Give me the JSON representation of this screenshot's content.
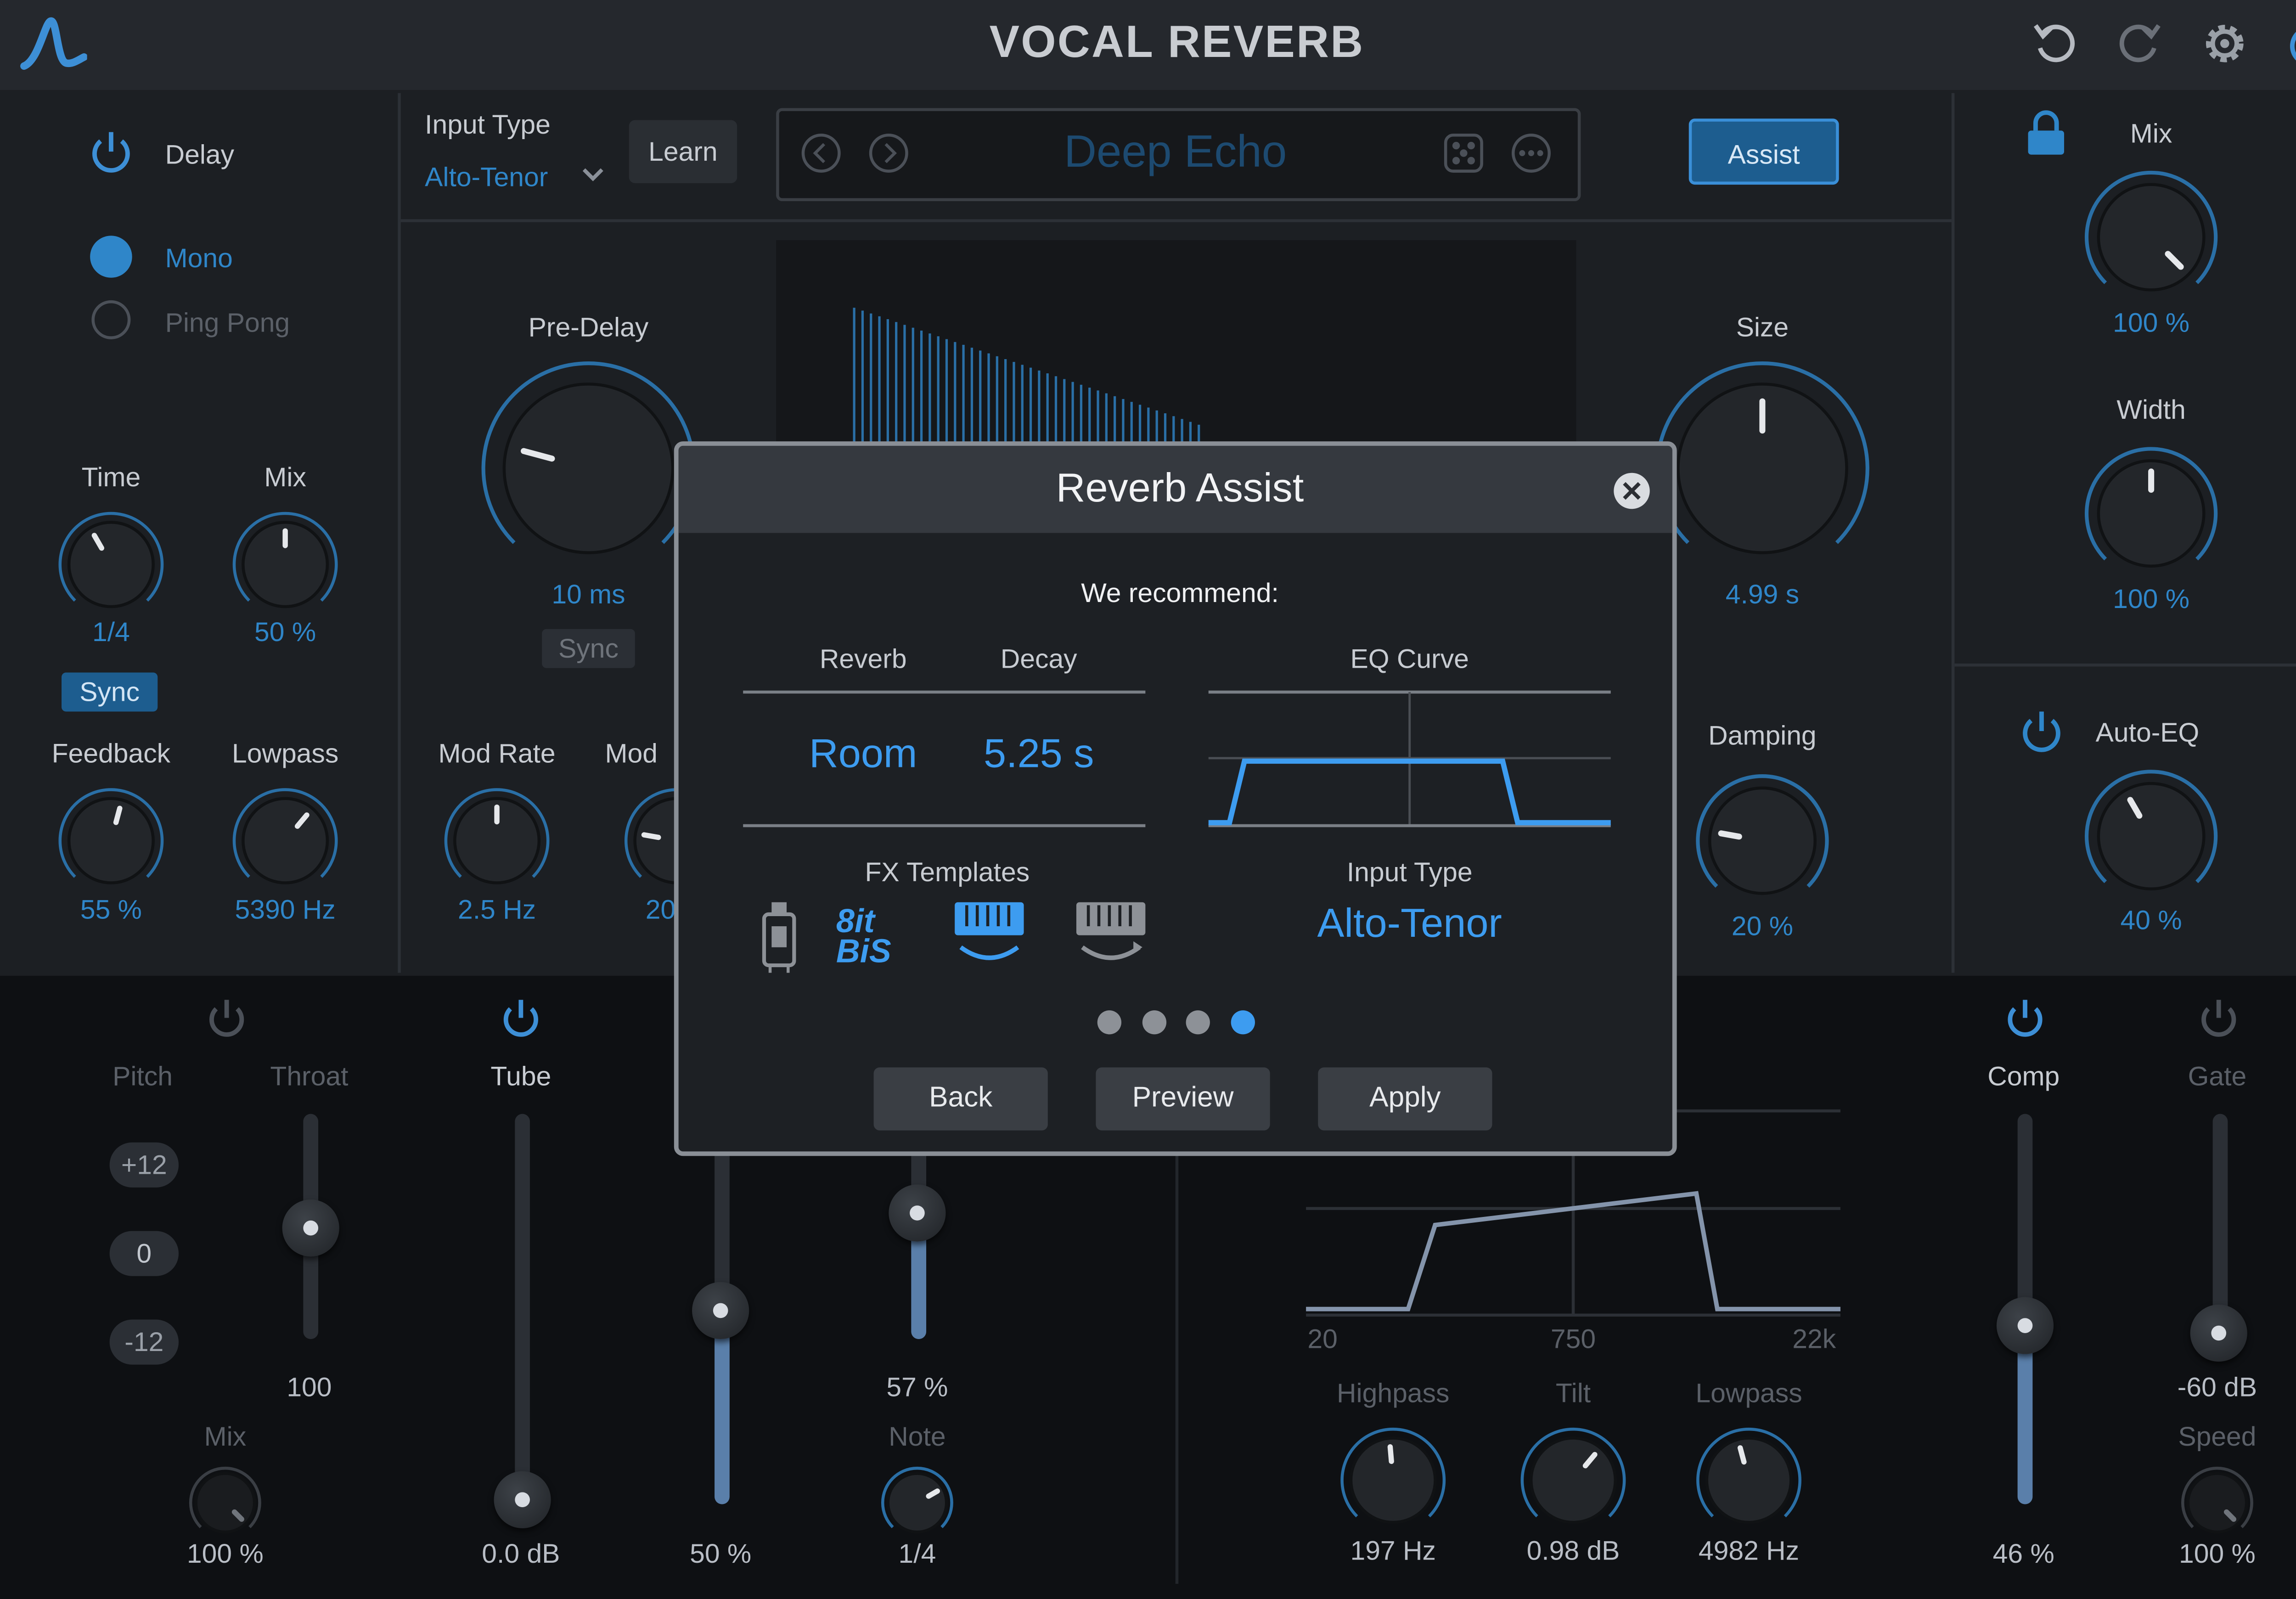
{
  "app": {
    "title": "VOCAL REVERB"
  },
  "colors": {
    "accent": "#2f86c9",
    "bright_accent": "#3d9cf0",
    "panel": "#1c1f23",
    "lower_panel": "#0e1013",
    "modal_border": "#8a8f96"
  },
  "toolbar": {
    "icons": [
      "logo-icon",
      "undo-icon",
      "redo-icon",
      "gear-icon",
      "power-icon"
    ]
  },
  "delay": {
    "title": "Delay",
    "modes": [
      "Mono",
      "Ping Pong"
    ],
    "selected_mode": "Mono",
    "time": {
      "label": "Time",
      "value": "1/4"
    },
    "mix": {
      "label": "Mix",
      "value": "50 %"
    },
    "sync_label": "Sync",
    "feedback": {
      "label": "Feedback",
      "value": "55 %"
    },
    "lowpass": {
      "label": "Lowpass",
      "value": "5390 Hz"
    }
  },
  "header": {
    "input_type_label": "Input Type",
    "input_type_value": "Alto-Tenor",
    "learn_label": "Learn",
    "preset_name": "Deep Echo",
    "assist_label": "Assist"
  },
  "reverb": {
    "predelay": {
      "label": "Pre-Delay",
      "value": "10 ms"
    },
    "sync_label": "Sync",
    "size": {
      "label": "Size",
      "value": "4.99 s"
    },
    "mod_rate": {
      "label": "Mod Rate",
      "value": "2.5 Hz"
    },
    "mod_depth": {
      "label": "Mod",
      "value": "20"
    },
    "damping": {
      "label": "Damping",
      "value": "20 %"
    }
  },
  "right": {
    "mix": {
      "label": "Mix",
      "value": "100 %"
    },
    "width": {
      "label": "Width",
      "value": "100 %"
    },
    "auto_eq": {
      "label": "Auto-EQ",
      "value": "40 %"
    }
  },
  "lower": {
    "pitch": {
      "label": "Pitch",
      "options": [
        "+12",
        "0",
        "-12"
      ],
      "selected": "0"
    },
    "throat": {
      "label": "Throat",
      "value": "100"
    },
    "pitch_mix": {
      "label": "Mix",
      "value": "100 %"
    },
    "tube": {
      "label": "Tube",
      "value": "0.0 dB"
    },
    "sat_value": "50 %",
    "note_slider_value": "57 %",
    "note": {
      "label": "Note",
      "value": "1/4"
    },
    "eq_axis": [
      "20",
      "750",
      "22k"
    ],
    "highpass": {
      "label": "Highpass",
      "value": "197 Hz"
    },
    "tilt": {
      "label": "Tilt",
      "value": "0.98 dB"
    },
    "lowpass": {
      "label": "Lowpass",
      "value": "4982 Hz"
    },
    "comp": {
      "label": "Comp",
      "value": "46 %"
    },
    "gate": {
      "label": "Gate",
      "value": "-60 dB"
    },
    "speed": {
      "label": "Speed",
      "value": "100 %"
    }
  },
  "modal": {
    "title": "Reverb Assist",
    "subtitle": "We recommend:",
    "reverb_header": "Reverb",
    "decay_header": "Decay",
    "eq_header": "EQ Curve",
    "reverb_value": "Room",
    "decay_value": "5.25 s",
    "fx_label": "FX Templates",
    "fx_templates": [
      "tube-template-icon",
      "bits-template-icon",
      "keys-template-icon",
      "keys-alt-template-icon"
    ],
    "input_type_label": "Input Type",
    "input_type_value": "Alto-Tenor",
    "page": {
      "current": 4,
      "total": 4
    },
    "buttons": {
      "back": "Back",
      "preview": "Preview",
      "apply": "Apply"
    }
  }
}
